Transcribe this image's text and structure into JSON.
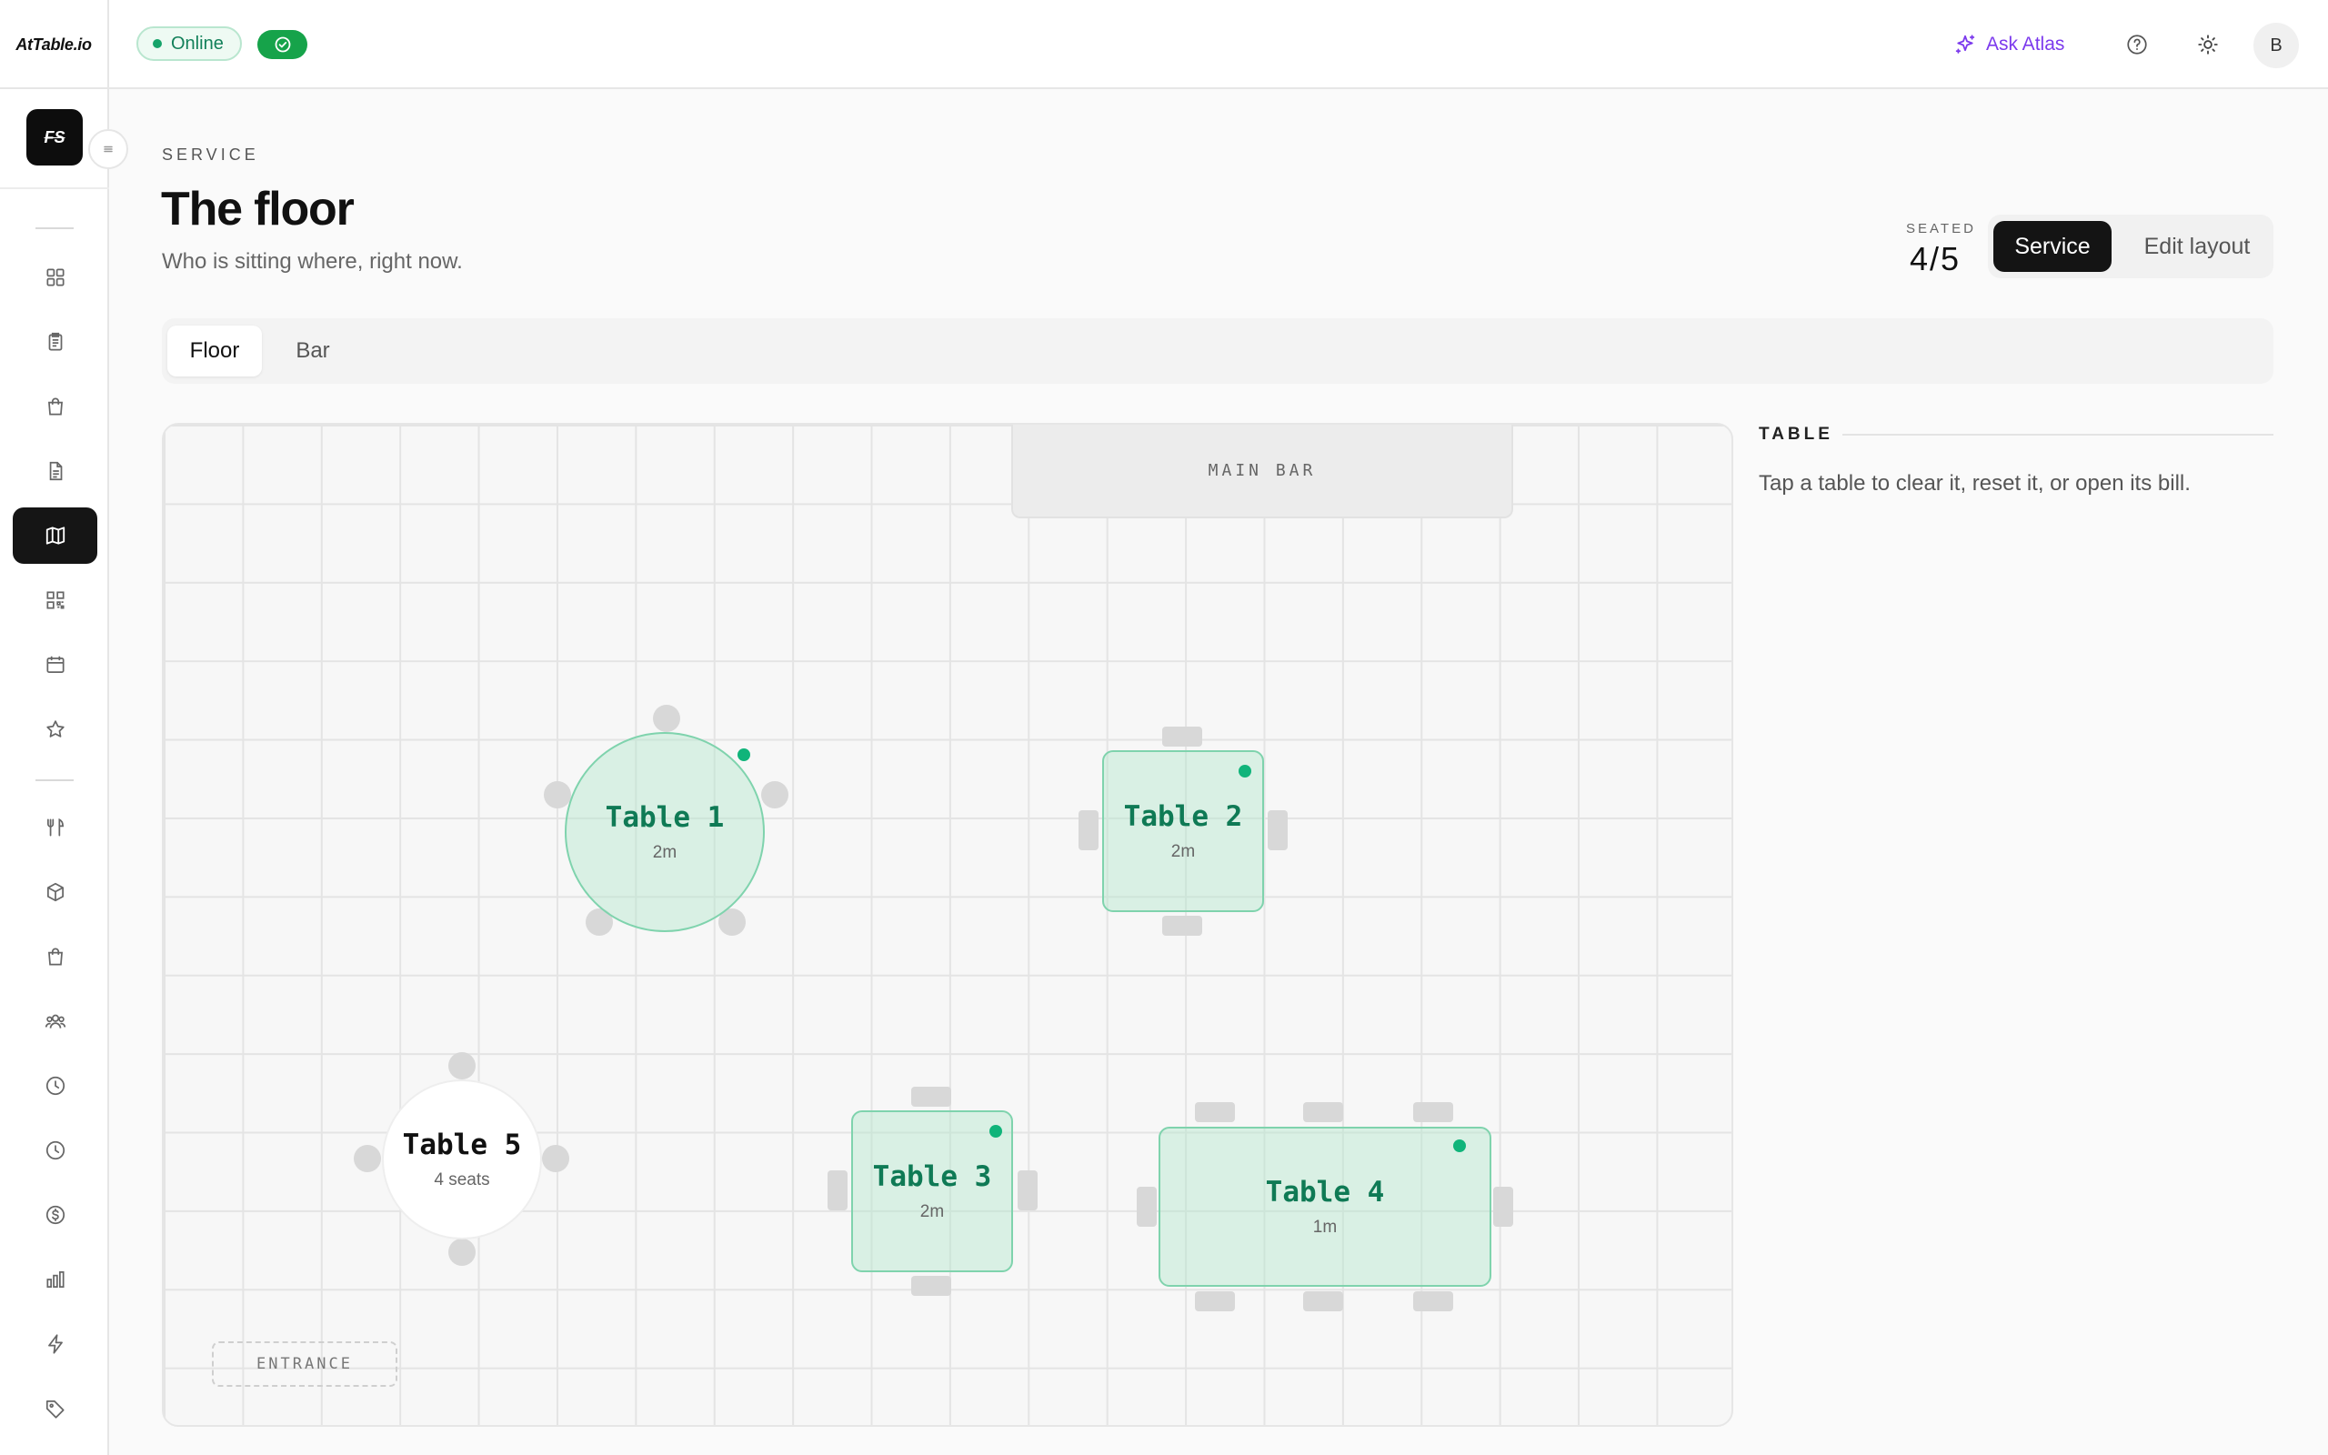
{
  "app": {
    "brand": "AtTable.io",
    "workspace_logo": "FS"
  },
  "header": {
    "status": "Online",
    "ask_atlas": "Ask Atlas",
    "avatar_initial": "B",
    "icons": [
      "sparkle-icon",
      "help-icon",
      "sun-icon"
    ]
  },
  "sidebar": {
    "items": [
      {
        "icon": "grid-icon",
        "active": false
      },
      {
        "icon": "clipboard-icon",
        "active": false
      },
      {
        "icon": "bag-icon",
        "active": false
      },
      {
        "icon": "document-icon",
        "active": false
      },
      {
        "icon": "map-icon",
        "active": true
      },
      {
        "icon": "qr-code-icon",
        "active": false
      },
      {
        "icon": "calendar-icon",
        "active": false
      },
      {
        "icon": "star-icon",
        "active": false
      },
      {
        "icon": "utensils-icon",
        "active": false
      },
      {
        "icon": "box-icon",
        "active": false
      },
      {
        "icon": "shopping-bag-icon",
        "active": false
      },
      {
        "icon": "users-icon",
        "active": false
      },
      {
        "icon": "clock-icon",
        "active": false
      },
      {
        "icon": "history-icon",
        "active": false
      },
      {
        "icon": "dollar-icon",
        "active": false
      },
      {
        "icon": "bar-chart-icon",
        "active": false
      },
      {
        "icon": "lightning-icon",
        "active": false
      },
      {
        "icon": "tag-icon",
        "active": false
      }
    ]
  },
  "page": {
    "eyebrow": "SERVICE",
    "title": "The floor",
    "subtitle": "Who is sitting where, right now.",
    "seated_label": "SEATED",
    "seated_value": "4/5",
    "modes": {
      "service": "Service",
      "edit": "Edit layout",
      "selected": "Service"
    }
  },
  "tabs": [
    {
      "label": "Floor",
      "active": true
    },
    {
      "label": "Bar",
      "active": false
    }
  ],
  "floor": {
    "zones": {
      "bar": "MAIN BAR",
      "entrance": "ENTRANCE"
    },
    "tables": [
      {
        "name": "Table 1",
        "meta": "2m",
        "status": "occupied",
        "seats": 5
      },
      {
        "name": "Table 2",
        "meta": "2m",
        "status": "occupied",
        "seats": 4
      },
      {
        "name": "Table 3",
        "meta": "2m",
        "status": "occupied",
        "seats": 4
      },
      {
        "name": "Table 4",
        "meta": "1m",
        "status": "occupied",
        "seats": 8
      },
      {
        "name": "Table 5",
        "meta": "4 seats",
        "status": "free",
        "seats": 4
      }
    ]
  },
  "panel": {
    "title": "TABLE",
    "hint": "Tap a table to clear it, reset it, or open its bill."
  },
  "colors": {
    "occupied": "#10b47a",
    "online": "#16a36a",
    "atlas": "#7c3aed",
    "active_nav": "#151515"
  }
}
